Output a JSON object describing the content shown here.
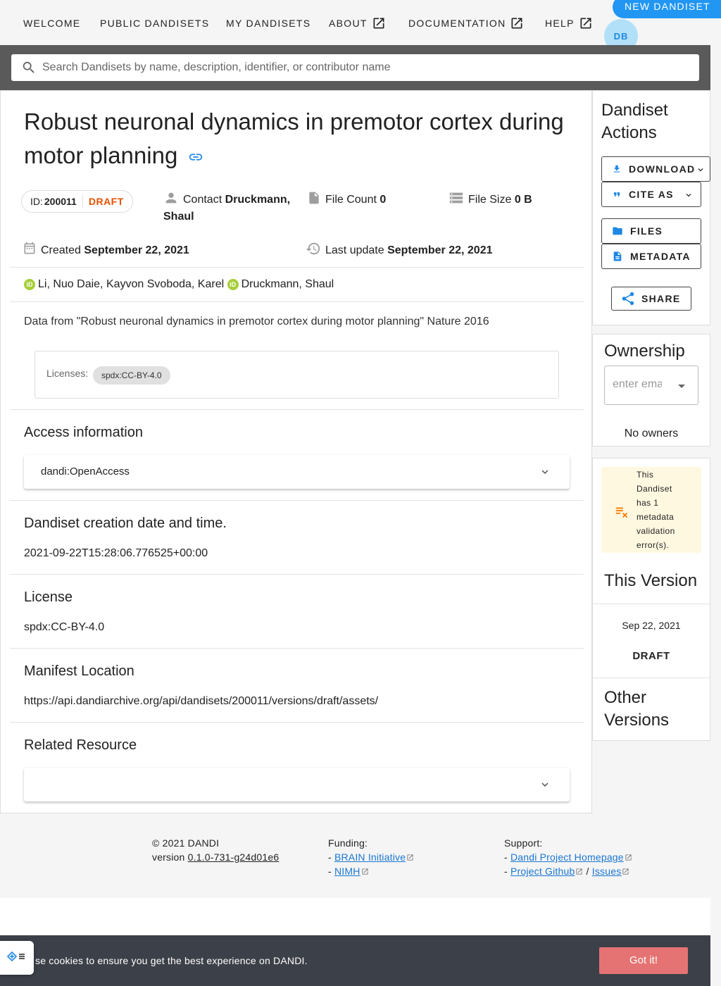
{
  "nav": {
    "items": [
      "WELCOME",
      "PUBLIC DANDISETS",
      "MY DANDISETS",
      "ABOUT",
      "DOCUMENTATION",
      "HELP"
    ],
    "new_button": "NEW DANDISET",
    "avatar_initials": "DB"
  },
  "search": {
    "placeholder": "Search Dandisets by name, description, identifier, or contributor name"
  },
  "dandiset": {
    "title": "Robust neuronal dynamics in premotor cortex during motor planning",
    "id_label": "ID:",
    "id": "200011",
    "status": "DRAFT",
    "contact_label": "Contact",
    "contact_name": "Druckmann, Shaul",
    "file_count_label": "File Count",
    "file_count": "0",
    "file_size_label": "File Size",
    "file_size": "0 B",
    "created_label": "Created",
    "created": "September 22, 2021",
    "updated_label": "Last update",
    "updated": "September 22, 2021",
    "contributors_a": "Li, Nuo Daie, Kayvon Svoboda, Karel",
    "contributors_b": "Druckmann, Shaul",
    "description": "Data from \"Robust neuronal dynamics in premotor cortex during motor planning\" Nature 2016",
    "licenses_label": "Licenses:",
    "license_chip": "spdx:CC-BY-4.0"
  },
  "sections": {
    "access_title": "Access information",
    "access_value": "dandi:OpenAccess",
    "creation_title": "Dandiset creation date and time.",
    "creation_value": "2021-09-22T15:28:06.776525+00:00",
    "license_title": "License",
    "license_value": "spdx:CC-BY-4.0",
    "manifest_title": "Manifest Location",
    "manifest_value": "https://api.dandiarchive.org/api/dandisets/200011/versions/draft/assets/",
    "related_title": "Related Resource"
  },
  "sidebar": {
    "actions_title": "Dandiset Actions",
    "download": "DOWNLOAD",
    "cite": "CITE AS",
    "files": "FILES",
    "metadata": "METADATA",
    "share": "SHARE",
    "ownership_title": "Ownership",
    "owner_placeholder": "enter email",
    "no_owners": "No owners",
    "warning": "This Dandiset has 1 metadata validation error(s).",
    "this_version_title": "This Version",
    "version_date": "Sep 22, 2021",
    "version_name": "DRAFT",
    "other_versions_title": "Other Versions"
  },
  "footer": {
    "copyright": "© 2021 DANDI",
    "version_label": "version",
    "version": "0.1.0-731-g24d01e6",
    "funding_label": "Funding:",
    "funding_links": [
      "BRAIN Initiative",
      "NIMH"
    ],
    "support_label": "Support:",
    "support_home": "Dandi Project Homepage",
    "support_github": "Project Github",
    "support_issues": "Issues"
  },
  "cookie": {
    "text": "se cookies to ensure you get the best experience on DANDI.",
    "button": "Got it!"
  },
  "colors": {
    "primary": "#2196f3",
    "draft": "#e65100",
    "cookie_button": "#e57373",
    "orcid": "#a6ce39"
  }
}
